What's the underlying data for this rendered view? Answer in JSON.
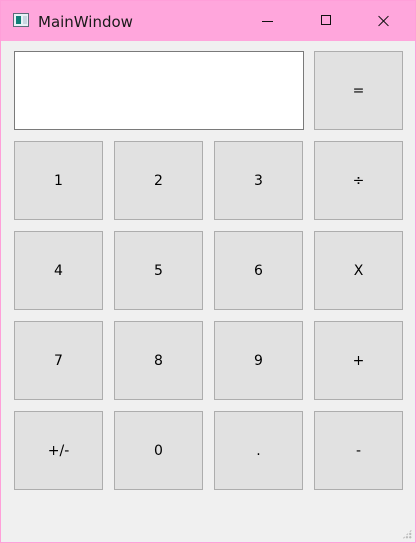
{
  "window": {
    "title": "MainWindow"
  },
  "display": {
    "value": ""
  },
  "keys": {
    "equals": "=",
    "one": "1",
    "two": "2",
    "three": "3",
    "divide": "÷",
    "four": "4",
    "five": "5",
    "six": "6",
    "multiply": "X",
    "seven": "7",
    "eight": "8",
    "nine": "9",
    "plus": "+",
    "sign": "+/-",
    "zero": "0",
    "decimal": ".",
    "minus": "-"
  },
  "icons": {
    "app": "app-window-icon",
    "minimize": "minimize-icon",
    "maximize": "maximize-icon",
    "close": "close-icon",
    "resize": "size-grip-icon"
  },
  "colors": {
    "titlebar": "#ffa6dc",
    "window_background": "#f0f0f0",
    "button_background": "#e1e1e1",
    "button_border": "#adadad",
    "display_background": "#ffffff"
  }
}
